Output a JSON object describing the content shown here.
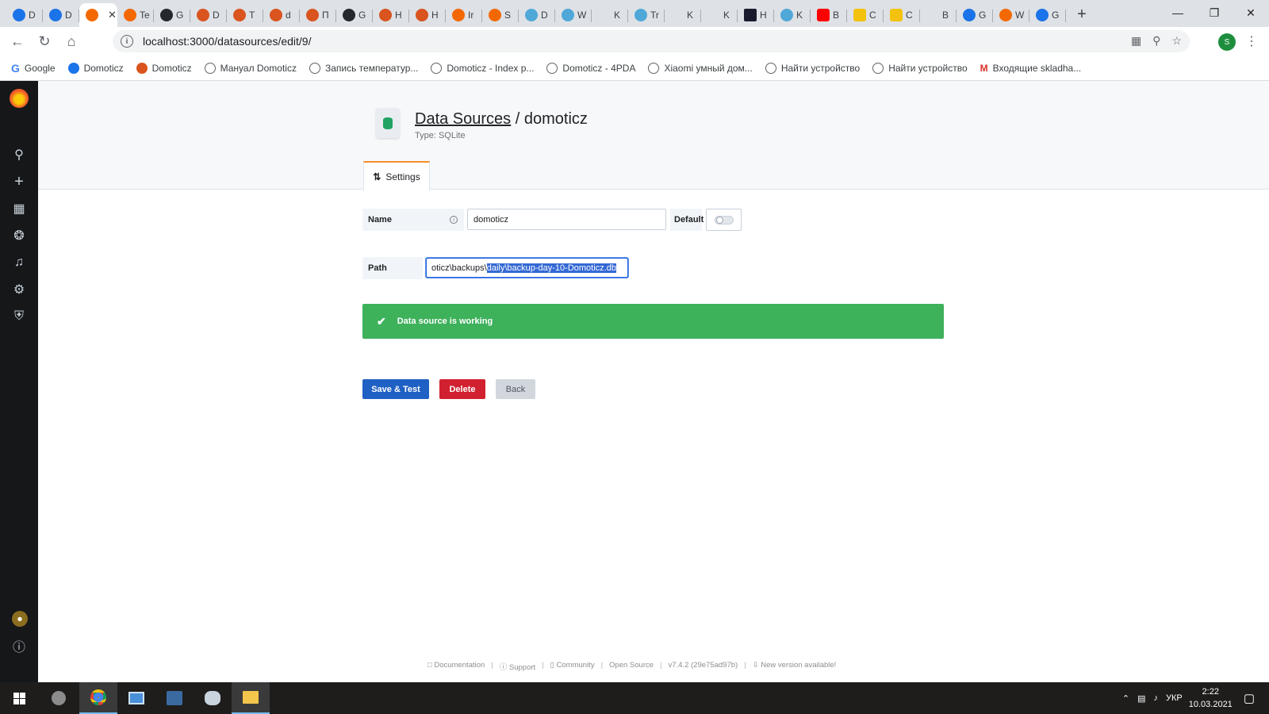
{
  "browser": {
    "tabs": [
      {
        "letter": "D",
        "icon": "domoticz-icon",
        "color": "blue"
      },
      {
        "letter": "D",
        "icon": "domoticz-icon",
        "color": "blue"
      },
      {
        "letter": "",
        "icon": "grafana-icon",
        "color": "grafana",
        "active": true
      },
      {
        "letter": "Te",
        "icon": "grafana-icon",
        "color": "grafana"
      },
      {
        "letter": "G",
        "icon": "github-icon",
        "color": "github"
      },
      {
        "letter": "D",
        "icon": "domoticz-orange-icon",
        "color": "orange"
      },
      {
        "letter": "T",
        "icon": "domoticz-orange-icon",
        "color": "orange"
      },
      {
        "letter": "d",
        "icon": "domoticz-orange-icon",
        "color": "orange"
      },
      {
        "letter": "П",
        "icon": "domoticz-orange-icon",
        "color": "orange"
      },
      {
        "letter": "G",
        "icon": "github-icon",
        "color": "github"
      },
      {
        "letter": "H",
        "icon": "domoticz-orange-icon",
        "color": "orange"
      },
      {
        "letter": "H",
        "icon": "domoticz-orange-icon",
        "color": "orange"
      },
      {
        "letter": "Ir",
        "icon": "grafana-icon",
        "color": "grafana"
      },
      {
        "letter": "S",
        "icon": "grafana-icon",
        "color": "grafana"
      },
      {
        "letter": "D",
        "icon": "globe-icon",
        "color": "cyan"
      },
      {
        "letter": "W",
        "icon": "globe-icon",
        "color": "cyan"
      },
      {
        "letter": "K",
        "icon": "code-icon",
        "color": "code"
      },
      {
        "letter": "Tr",
        "icon": "globe-icon",
        "color": "cyan"
      },
      {
        "letter": "K",
        "icon": "code-icon",
        "color": "code"
      },
      {
        "letter": "K",
        "icon": "code-icon",
        "color": "code"
      },
      {
        "letter": "H",
        "icon": "bookmark-dark-icon",
        "color": "dark"
      },
      {
        "letter": "K",
        "icon": "globe-icon",
        "color": "cyan"
      },
      {
        "letter": "B",
        "icon": "youtube-icon",
        "color": "yt"
      },
      {
        "letter": "C",
        "icon": "yellow-icon",
        "color": "yellow"
      },
      {
        "letter": "C",
        "icon": "yellow-icon",
        "color": "yellow"
      },
      {
        "letter": "B",
        "icon": "gmail-icon",
        "color": "gmail"
      },
      {
        "letter": "G",
        "icon": "translate-icon",
        "color": "blue"
      },
      {
        "letter": "W",
        "icon": "grafana-icon",
        "color": "grafana"
      },
      {
        "letter": "G",
        "icon": "translate-icon",
        "color": "blue"
      }
    ],
    "url": "localhost:3000/datasources/edit/9/",
    "profile_initial": "S",
    "bookmarks": [
      {
        "label": "Google",
        "icon": "google-icon"
      },
      {
        "label": "Domoticz",
        "icon": "domoticz-icon"
      },
      {
        "label": "Domoticz",
        "icon": "domoticz-orange-icon"
      },
      {
        "label": "Мануал Domoticz",
        "icon": "globe-icon"
      },
      {
        "label": "Запись температур...",
        "icon": "globe-icon"
      },
      {
        "label": "Domoticz - Index p...",
        "icon": "globe-icon"
      },
      {
        "label": "Domoticz - 4PDA",
        "icon": "globe-icon"
      },
      {
        "label": "Xiaomi умный дом...",
        "icon": "globe-icon"
      },
      {
        "label": "Найти устройство",
        "icon": "globe-icon"
      },
      {
        "label": "Найти устройство",
        "icon": "globe-icon"
      },
      {
        "label": "Входящие skladha...",
        "icon": "gmail-icon"
      }
    ]
  },
  "header": {
    "breadcrumb_link": "Data Sources",
    "separator": "/",
    "title": "domoticz",
    "subtitle": "Type: SQLite",
    "tab_settings": "Settings"
  },
  "form": {
    "name_label": "Name",
    "name_value": "domoticz",
    "default_label": "Default",
    "default_enabled": false,
    "path_label": "Path",
    "path_value_visible": "oticz\\backups\\",
    "path_value_selected": "daily\\backup-day-10-Domoticz.db"
  },
  "alert": {
    "message": "Data source is working",
    "color": "#3eb15b"
  },
  "buttons": {
    "save": "Save & Test",
    "delete": "Delete",
    "back": "Back"
  },
  "footer": {
    "documentation": "Documentation",
    "support": "Support",
    "community": "Community",
    "open_source": "Open Source",
    "version": "v7.4.2 (29e75ad97b)",
    "new_version": "New version available!"
  },
  "taskbar": {
    "language": "УКР",
    "time": "2:22",
    "date": "10.03.2021"
  }
}
